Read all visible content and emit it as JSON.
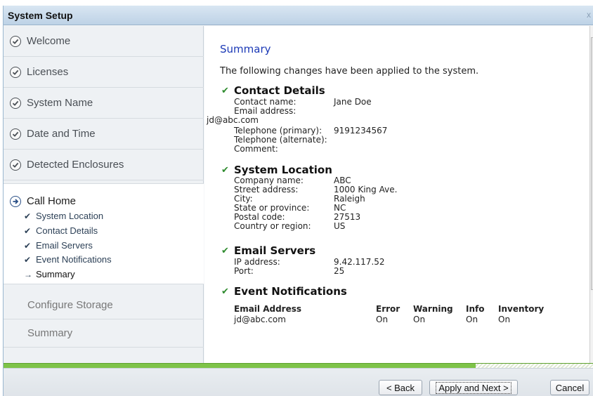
{
  "window": {
    "title": "System Setup",
    "close_glyph": "x"
  },
  "sidebar": {
    "completed_steps": [
      {
        "label": "Welcome",
        "icon": "check-circle-icon"
      },
      {
        "label": "Licenses",
        "icon": "check-circle-icon"
      },
      {
        "label": "System Name",
        "icon": "check-circle-icon"
      },
      {
        "label": "Date and Time",
        "icon": "check-circle-icon"
      },
      {
        "label": "Detected Enclosures",
        "icon": "check-circle-icon"
      }
    ],
    "current_step": {
      "label": "Call Home",
      "icon": "arrow-circle-icon",
      "sub_steps": [
        {
          "label": "System Location",
          "mark": "✔"
        },
        {
          "label": "Contact Details",
          "mark": "✔"
        },
        {
          "label": "Email Servers",
          "mark": "✔"
        },
        {
          "label": "Event Notifications",
          "mark": "✔"
        },
        {
          "label": "Summary",
          "mark": "→"
        }
      ]
    },
    "pending_steps": [
      {
        "label": "Configure Storage"
      },
      {
        "label": "Summary"
      }
    ]
  },
  "main": {
    "title": "Summary",
    "intro": "The following changes have been applied to the system.",
    "contact": {
      "heading": "Contact Details",
      "name_label": "Contact name:",
      "name_value": "Jane Doe",
      "email_label": "Email address:",
      "email_value": "jd@abc.com",
      "tel_primary_label": "Telephone (primary):",
      "tel_primary_value": "9191234567",
      "tel_alt_label": "Telephone (alternate):",
      "comment_label": "Comment:"
    },
    "location": {
      "heading": "System Location",
      "rows": [
        {
          "label": "Company name:",
          "value": "ABC"
        },
        {
          "label": "Street address:",
          "value": "1000 King Ave."
        },
        {
          "label": "City:",
          "value": "Raleigh"
        },
        {
          "label": "State or province:",
          "value": "NC"
        },
        {
          "label": "Postal code:",
          "value": "27513"
        },
        {
          "label": "Country or region:",
          "value": "US"
        }
      ]
    },
    "servers": {
      "heading": "Email Servers",
      "ip_label": "IP address:",
      "ip_value": "9.42.117.52",
      "port_label": "Port:",
      "port_value": "25"
    },
    "notifications": {
      "heading": "Event Notifications",
      "columns": [
        "Email Address",
        "Error",
        "Warning",
        "Info",
        "Inventory"
      ],
      "rows": [
        [
          "jd@abc.com",
          "On",
          "On",
          "On",
          "On"
        ]
      ]
    }
  },
  "footer": {
    "back_label": "< Back",
    "apply_label": "Apply and Next >",
    "cancel_label": "Cancel"
  },
  "colors": {
    "accent_title": "#1b39b6",
    "progress": "#7ec348",
    "tick": "#2e8b2e"
  }
}
